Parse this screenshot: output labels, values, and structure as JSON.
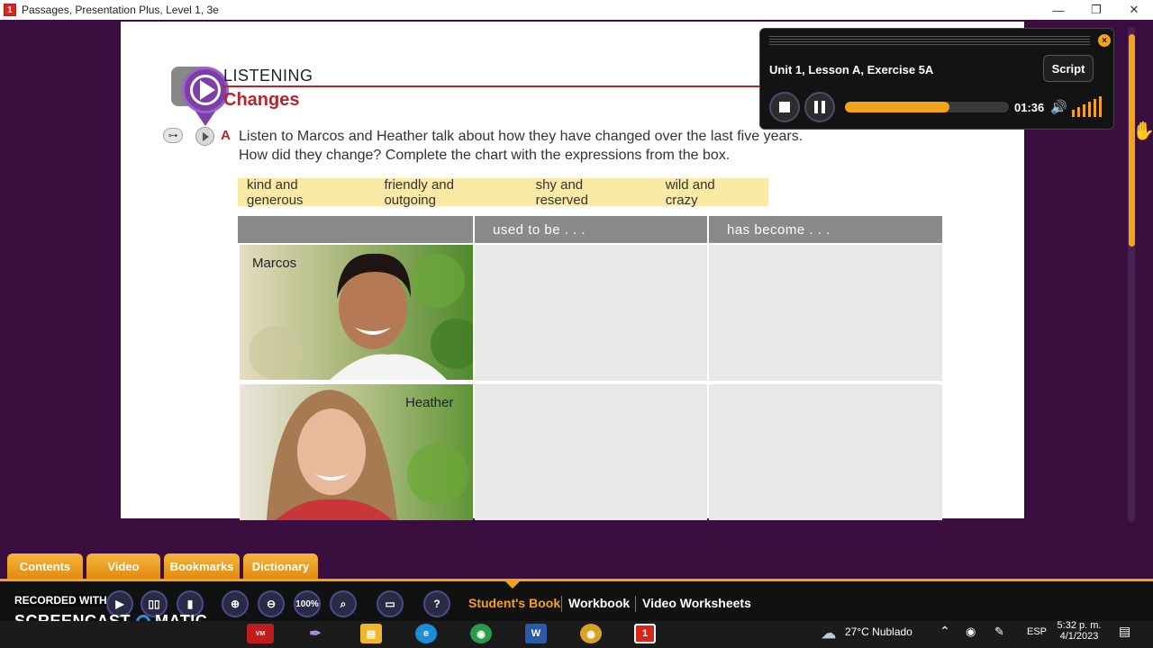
{
  "window": {
    "title": "Passages, Presentation Plus, Level 1, 3e",
    "app_badge": "1",
    "minimize": "—",
    "restore": "❐",
    "close": "✕"
  },
  "section": {
    "label": "LISTENING",
    "title": "Changes",
    "exercise_letter": "A",
    "instruction_line1": "Listen to Marcos and Heather talk about how they have changed over the last five years.",
    "instruction_line2": "How did they change? Complete the chart with the expressions from the box.",
    "word_box": [
      "kind and generous",
      "friendly and outgoing",
      "shy and reserved",
      "wild and crazy"
    ],
    "key_symbol": "⊶"
  },
  "chart_table": {
    "headers": [
      "",
      "used to be . . .",
      "has become . . ."
    ],
    "rows": [
      {
        "name": "Marcos"
      },
      {
        "name": "Heather"
      }
    ]
  },
  "player": {
    "title": "Unit 1, Lesson A, Exercise 5A",
    "script_label": "Script",
    "time": "01:36",
    "progress": 0.64,
    "close_symbol": "×",
    "volume_symbol": "🔊",
    "volume_level": 6
  },
  "bottom_tabs": [
    "Contents",
    "Video",
    "Bookmarks",
    "Dictionary"
  ],
  "toolbar": {
    "zoom_level": "100%",
    "help": "?",
    "books": [
      "Student's Book",
      "Workbook",
      "Video Worksheets"
    ]
  },
  "overlay": {
    "recorded_with": "RECORDED WITH",
    "brand": "SCREENCAST",
    "brand_suffix": "MATIC"
  },
  "taskbar": {
    "weather": "27°C  Nublado",
    "language": "ESP",
    "time": "5:32 p. m.",
    "date": "4/1/2023"
  },
  "colors": {
    "accent_orange": "#f2a31a",
    "background_purple": "#3a0f3f",
    "section_red": "#b8242a",
    "pin_purple": "#7b3fa6"
  }
}
